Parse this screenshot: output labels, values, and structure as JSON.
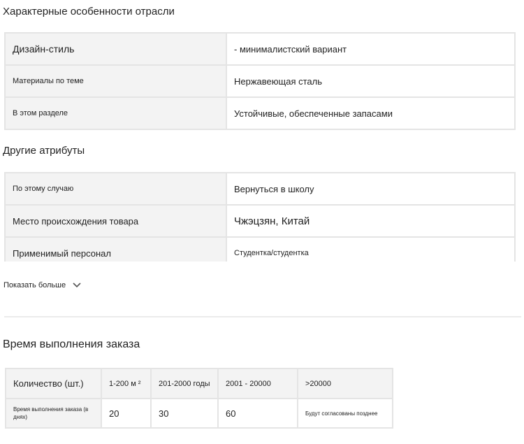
{
  "industry": {
    "title": "Характерные особенности отрасли",
    "rows": [
      {
        "key": "Дизайн-стиль",
        "value": "- минималистский вариант"
      },
      {
        "key": "Материалы по теме",
        "value": "Нержавеющая сталь"
      },
      {
        "key": "В этом разделе",
        "value": "Устойчивые, обеспеченные запасами"
      }
    ]
  },
  "other": {
    "title": "Другие атрибуты",
    "rows": [
      {
        "key": "По этому случаю",
        "value": "Вернуться в школу"
      },
      {
        "key": "Место происхождения товара",
        "value": "Чжэцзян, Китай"
      },
      {
        "key": "Применимый персонал",
        "value": "Студентка/студентка"
      }
    ],
    "show_more": "Показать больше",
    "show_more_icon": "chevron-down-icon"
  },
  "lead_time": {
    "title": "Время выполнения заказа",
    "header": [
      "Количество (шт.)",
      "1-200 м ²",
      "201-2000 годы",
      "2001 - 20000",
      ">20000"
    ],
    "row": [
      "Время выполнения заказа (в днях)",
      "20",
      "30",
      "60",
      "Будут согласованы позднее"
    ]
  }
}
